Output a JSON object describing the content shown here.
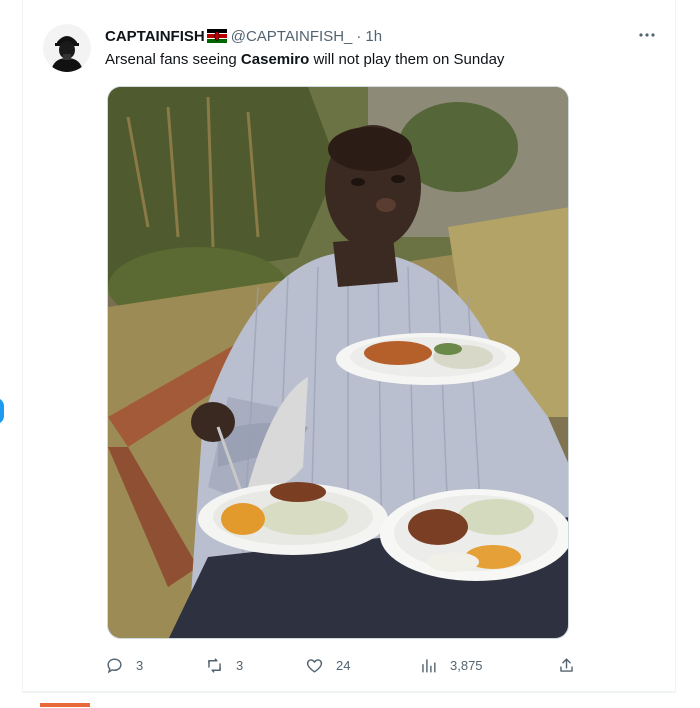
{
  "tweet": {
    "author_name": "CAPTAINFISH",
    "author_handle": "@CAPTAINFISH_",
    "separator": "·",
    "time": "1h",
    "text_before": "Arsenal fans seeing ",
    "text_bold": "Casemiro",
    "text_after": " will not play them on Sunday",
    "flag_icon": "kenya-flag-icon",
    "more_icon": "more-options-icon"
  },
  "actions": {
    "replies": "3",
    "retweets": "3",
    "likes": "24",
    "views": "3,875"
  },
  "colors": {
    "text": "#0f1419",
    "secondary": "#536471",
    "border": "#cfd9de",
    "accent": "#1d9bf0"
  }
}
